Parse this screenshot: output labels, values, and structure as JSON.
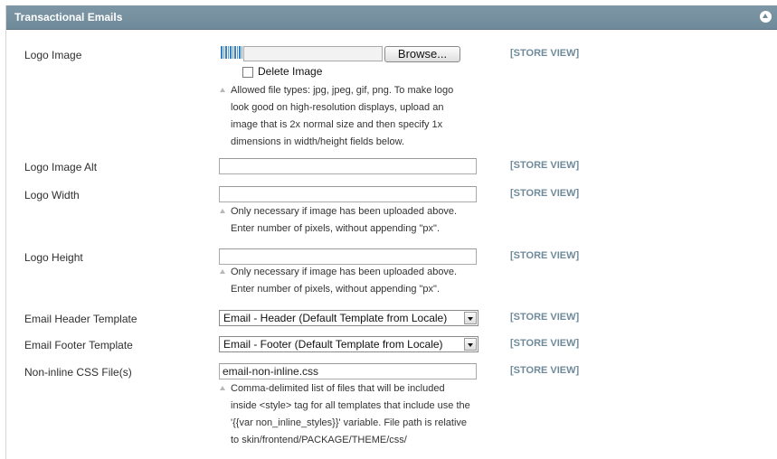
{
  "panel": {
    "title": "Transactional Emails",
    "collapse_icon": "collapse-icon"
  },
  "fields": {
    "logo_image": {
      "label": "Logo Image",
      "browse_label": "Browse...",
      "delete_label": "Delete Image",
      "scope": "[STORE VIEW]",
      "note": [
        "Allowed file types: jpg, jpeg, gif, png. To make logo",
        "look good on high-resolution displays, upload an",
        "image that is 2x normal size and then specify 1x",
        "dimensions in width/height fields below."
      ]
    },
    "logo_image_alt": {
      "label": "Logo Image Alt",
      "value": "",
      "scope": "[STORE VIEW]"
    },
    "logo_width": {
      "label": "Logo Width",
      "value": "",
      "scope": "[STORE VIEW]",
      "note": [
        "Only necessary if image has been uploaded above.",
        "Enter number of pixels, without appending \"px\"."
      ]
    },
    "logo_height": {
      "label": "Logo Height",
      "value": "",
      "scope": "[STORE VIEW]",
      "note": [
        "Only necessary if image has been uploaded above.",
        "Enter number of pixels, without appending \"px\"."
      ]
    },
    "email_header_template": {
      "label": "Email Header Template",
      "selected": "Email - Header (Default Template from Locale)",
      "scope": "[STORE VIEW]"
    },
    "email_footer_template": {
      "label": "Email Footer Template",
      "selected": "Email - Footer (Default Template from Locale)",
      "scope": "[STORE VIEW]"
    },
    "non_inline_css": {
      "label": "Non-inline CSS File(s)",
      "value": "email-non-inline.css",
      "scope": "[STORE VIEW]",
      "note": [
        "Comma-delimited list of files that will be included",
        "inside <style> tag for all templates that include use the",
        "'{{var non_inline_styles}}' variable. File path is relative",
        "to skin/frontend/PACKAGE/THEME/css/"
      ]
    }
  },
  "colors": {
    "header_bg": "#6f8a9a",
    "scope_text": "#6f8a9a"
  }
}
